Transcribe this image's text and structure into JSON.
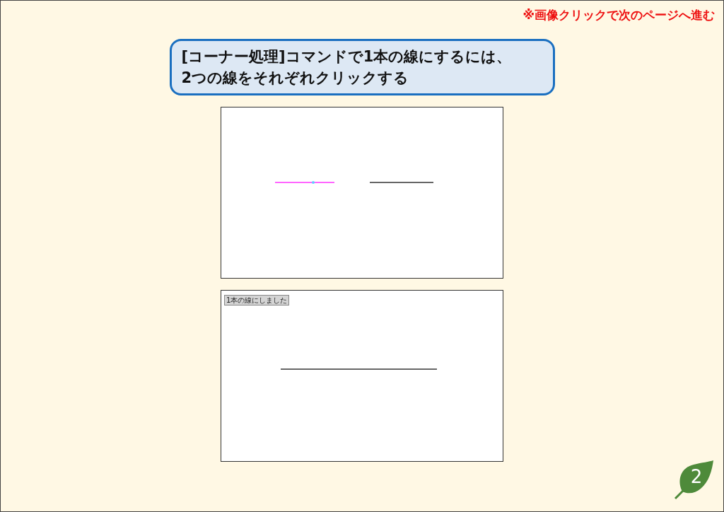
{
  "note": "※画像クリックで次のページへ進む",
  "callout": {
    "lines": [
      "[コーナー処理]コマンドで1本の線にするには、",
      "2つの線をそれぞれクリックする"
    ]
  },
  "panels": [
    {
      "lines": [
        {
          "selected": true
        },
        {
          "selected": false
        }
      ]
    },
    {
      "message": "1本の線にしました",
      "lines": [
        {
          "selected": false
        }
      ]
    }
  ],
  "page_number": "2"
}
